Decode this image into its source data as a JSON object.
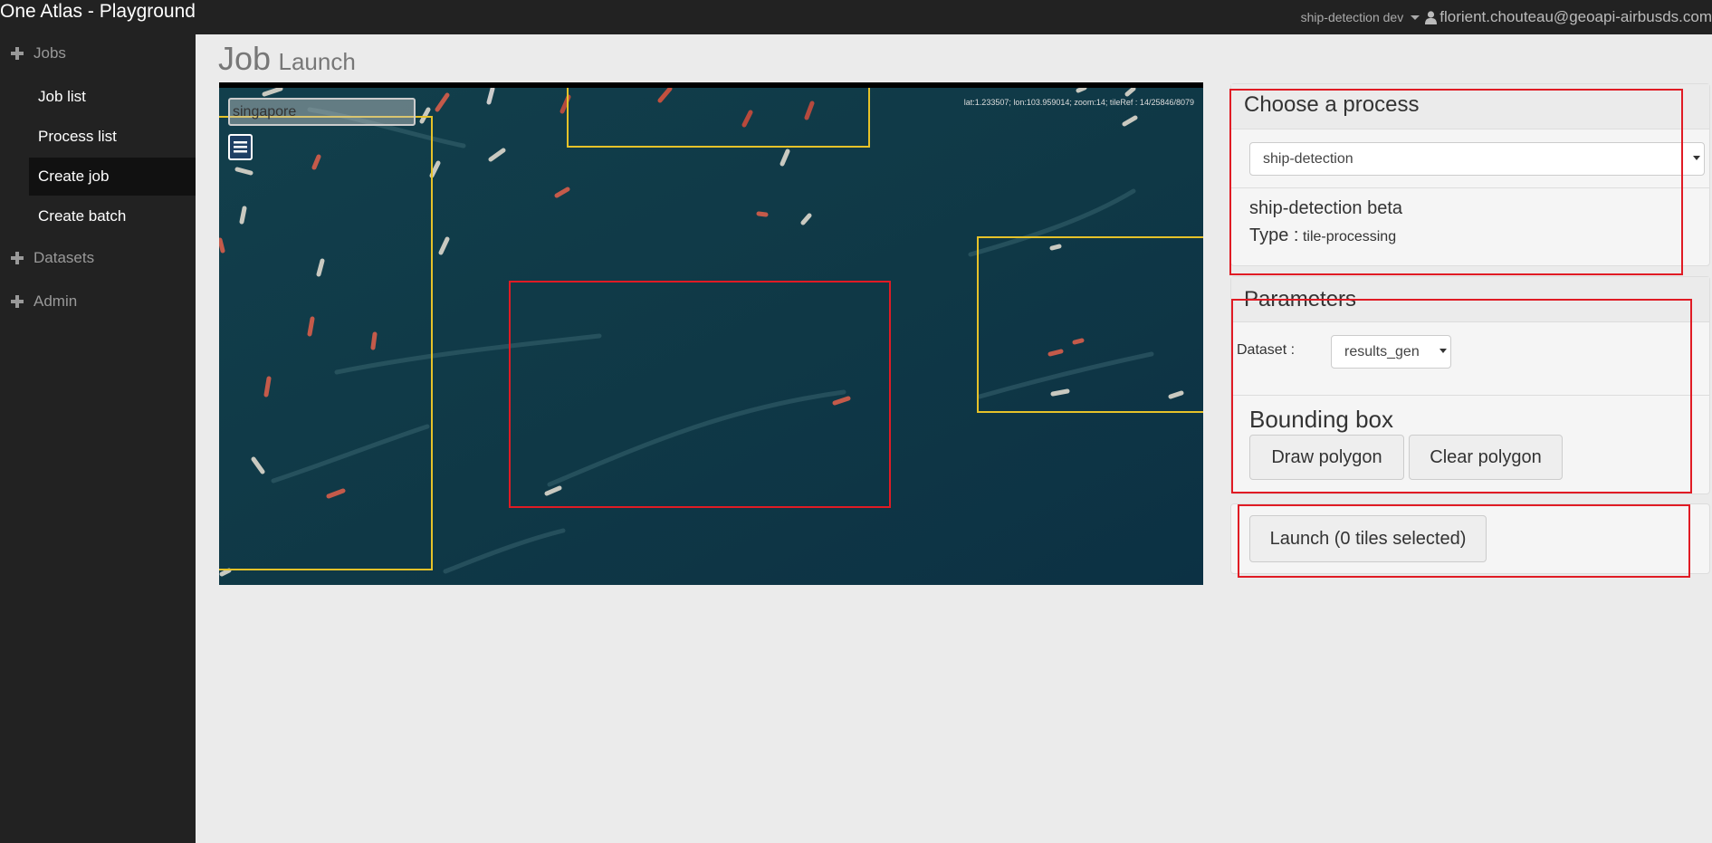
{
  "app": {
    "title": "One Atlas - Playground",
    "environment": "ship-detection dev",
    "user_email": "florient.chouteau@geoapi-airbusds.com"
  },
  "sidebar": {
    "groups": [
      {
        "label": "Jobs",
        "icon": "plus-icon"
      },
      {
        "label": "Datasets",
        "icon": "plus-icon"
      },
      {
        "label": "Admin",
        "icon": "plus-icon"
      }
    ],
    "items": [
      {
        "label": "Job list"
      },
      {
        "label": "Process list"
      },
      {
        "label": "Create job",
        "active": true
      },
      {
        "label": "Create batch"
      }
    ]
  },
  "page": {
    "title_main": "Job",
    "title_sub": "Launch"
  },
  "map": {
    "search_value": "singapore",
    "coordinates": "lat:1.233507; lon:103.959014; zoom:14; tileRef : 14/25846/8079",
    "layer_icon": "layers-menu-icon"
  },
  "process_panel": {
    "title": "Choose a process",
    "selected_process": "ship-detection",
    "process_name": "ship-detection beta",
    "type_label": "Type :",
    "type_value": "tile-processing"
  },
  "parameters_panel": {
    "title": "Parameters",
    "dataset_label": "Dataset :",
    "dataset_value": "results_gen",
    "bbox_title": "Bounding box",
    "draw_polygon_label": "Draw polygon",
    "clear_polygon_label": "Clear polygon"
  },
  "launch_panel": {
    "launch_label": "Launch (0 tiles selected)"
  },
  "colors": {
    "navbar": "#222222",
    "page_bg": "#ebebeb",
    "selected_tile": "#e6c229",
    "annotation": "#e01b24",
    "sea": "#0f3a47"
  }
}
